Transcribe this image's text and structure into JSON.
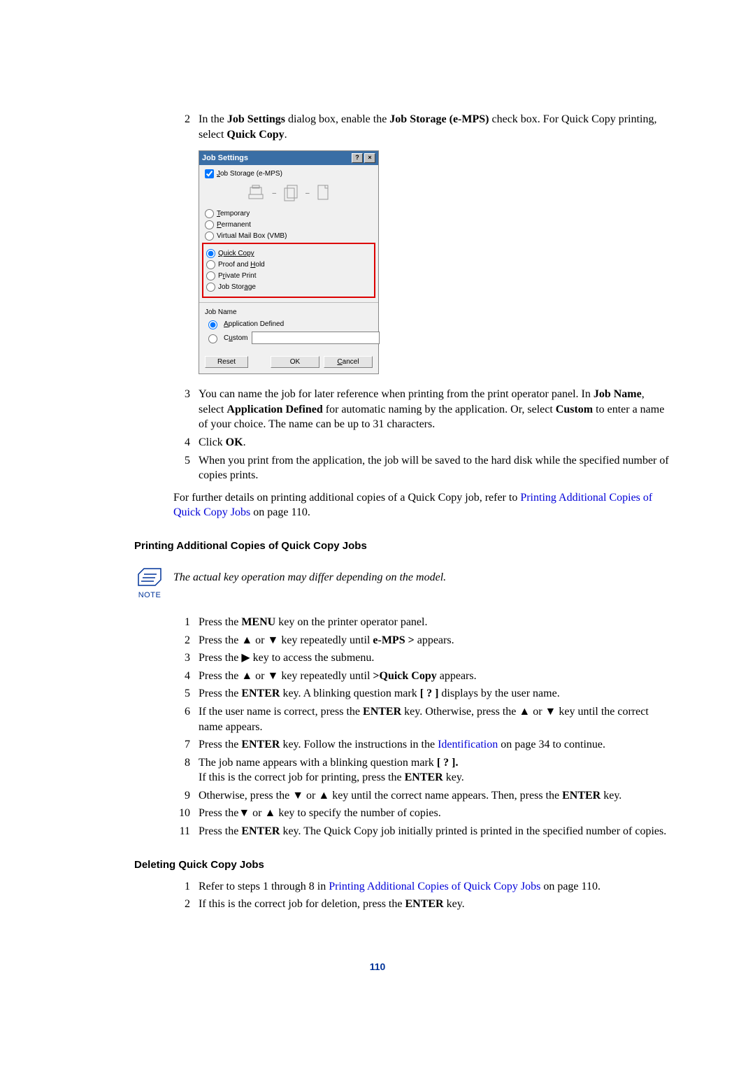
{
  "step2": {
    "text_before": "In the ",
    "b1": "Job Settings",
    "text_mid1": " dialog box, enable the ",
    "b2": "Job Storage (e-MPS)",
    "text_mid2": " check box. For Quick Copy printing, select ",
    "b3": "Quick Copy",
    "text_after": "."
  },
  "dialog": {
    "title": "Job Settings",
    "jobstorage": "Job Storage (e-MPS)",
    "temporary": "Temporary",
    "permanent": "Permanent",
    "vmb": "Virtual Mail Box (VMB)",
    "quickcopy": "Quick Copy",
    "proofhold": "Proof and Hold",
    "privateprint": "Private Print",
    "jobstoropt": "Job Storage",
    "jobname_label": "Job Name",
    "appdefined": "Application Defined",
    "custom": "Custom",
    "reset": "Reset",
    "ok": "OK",
    "cancel": "Cancel"
  },
  "step3": {
    "pre": "You can name the job for later reference when printing from the print operator panel. In ",
    "b1": "Job Name",
    "mid1": ", select ",
    "b2": "Application Defined",
    "mid2": " for automatic naming by the application. Or, select ",
    "b3": "Custom",
    "tail": " to enter a name of your choice. The name can be up to 31 characters."
  },
  "step4": {
    "pre": "Click ",
    "b1": "OK",
    "tail": "."
  },
  "step5": "When you print from the application, the job will be saved to the hard disk while the specified number of copies prints.",
  "refpara": {
    "pre": "For further details on printing additional copies of a Quick Copy job, refer to ",
    "link": "Printing Additional Copies of Quick Copy Jobs",
    "tail": " on page 110."
  },
  "heading1": "Printing Additional Copies of Quick Copy Jobs",
  "note": {
    "label": "NOTE",
    "text": "The actual key operation may differ depending on the model."
  },
  "b": {
    "s1": {
      "pre": "Press the ",
      "b1": "MENU",
      "tail": " key on the printer operator panel."
    },
    "s2": {
      "pre": "Press the ▲ or ▼ key repeatedly until ",
      "b1": "e-MPS >",
      "tail": " appears."
    },
    "s3": "Press the ▶ key to access the submenu.",
    "s4": {
      "pre": "Press the ▲ or ▼ key repeatedly until ",
      "b1": ">Quick Copy",
      "tail": " appears."
    },
    "s5": {
      "pre": "Press the ",
      "b1": "ENTER",
      "mid": " key. A blinking question mark ",
      "b2": "[ ? ]",
      "tail": " displays by the user name."
    },
    "s6": {
      "pre": "If the user name is correct, press the ",
      "b1": "ENTER",
      "mid": " key. Otherwise, press the ▲ or ▼ key until the correct name appears."
    },
    "s7": {
      "pre": "Press the ",
      "b1": "ENTER",
      "mid": " key. Follow the instructions in the ",
      "link": "Identification",
      "tail": " on page 34  to continue."
    },
    "s8": {
      "pre": "The job name appears with a blinking question mark ",
      "b1": "[ ? ].",
      "line2pre": "If this is the correct job for printing, press the ",
      "b2": "ENTER",
      "line2tail": " key."
    },
    "s9": {
      "pre": "Otherwise, press the ▼ or ▲ key until the correct name appears. Then, press the ",
      "b1": "ENTER",
      "tail": " key."
    },
    "s10": "Press the▼ or ▲ key to specify the number of copies.",
    "s11": {
      "pre": "Press the ",
      "b1": "ENTER",
      "tail": " key. The Quick Copy job initially printed is printed in the specified number of copies."
    }
  },
  "heading2": "Deleting Quick Copy Jobs",
  "c": {
    "s1": {
      "pre": "Refer to steps 1 through 8 in ",
      "link": "Printing Additional Copies of Quick Copy Jobs",
      "tail": " on page 110."
    },
    "s2": {
      "pre": "If this is the correct job for deletion, press the ",
      "b1": "ENTER",
      "tail": " key."
    }
  },
  "pagenum": "110"
}
